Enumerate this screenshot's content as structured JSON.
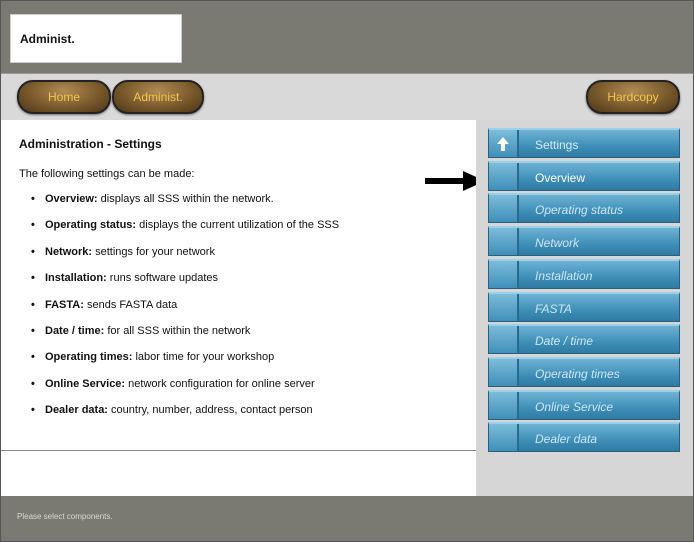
{
  "header": {
    "title": "Administ."
  },
  "nav": {
    "home": "Home",
    "admin": "Administ.",
    "hardcopy": "Hardcopy"
  },
  "main": {
    "title": "Administration - Settings",
    "intro": "The following settings can be made:",
    "items": [
      {
        "bold": "Overview:",
        "text": " displays all SSS within the network."
      },
      {
        "bold": "Operating status:",
        "text": " displays the current utilization of the SSS"
      },
      {
        "bold": "Network:",
        "text": " settings for your network"
      },
      {
        "bold": "Installation:",
        "text": " runs software updates"
      },
      {
        "bold": "FASTA:",
        "text": " sends FASTA data"
      },
      {
        "bold": "Date / time:",
        "text": " for all SSS within the network"
      },
      {
        "bold": "Operating times:",
        "text": " labor time for your workshop"
      },
      {
        "bold": "Online Service:",
        "text": " network configuration for online server"
      },
      {
        "bold": "Dealer data:",
        "text": " country, number, address, contact person"
      }
    ]
  },
  "menu": {
    "header": "Settings",
    "items": [
      "Overview",
      "Operating status",
      "Network",
      "Installation",
      "FASTA",
      "Date / time",
      "Operating times",
      "Online Service",
      "Dealer data"
    ],
    "active": "Overview"
  },
  "footer": {
    "status": "Please select components."
  }
}
